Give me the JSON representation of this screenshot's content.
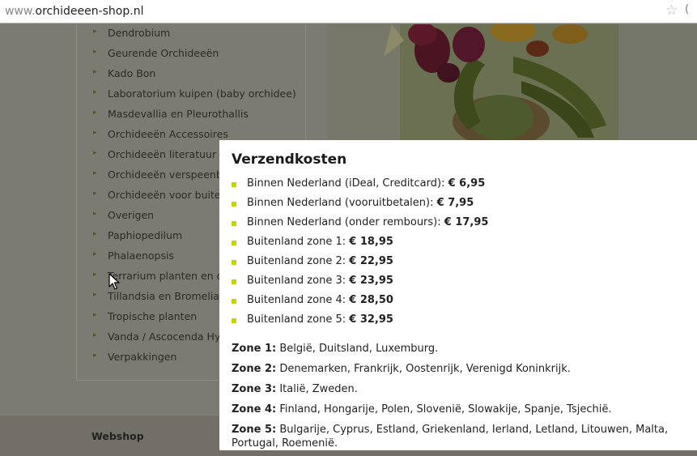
{
  "browser": {
    "url_prefix": "www.",
    "url_main": "orchideeen-shop.nl",
    "star_icon": "star-icon",
    "cut_glyph": "("
  },
  "sidebar": {
    "categories": [
      "Dendrobium",
      "Geurende Orchideeën",
      "Kado Bon",
      "Laboratorium kuipen (baby orchidee)",
      "Masdevallia en Pleurothallis",
      "Orchideeën Accessoires",
      "Orchideeën literatuur",
      "Orchideeën verspeenba",
      "Orchideeën voor buiter",
      "Overigen",
      "Paphiopedilum",
      "Phalaenopsis",
      "Terrarium planten en o",
      "Tillandsia en Bromelia",
      "Tropische planten",
      "Vanda / Ascocenda Hyb",
      "Verpakkingen"
    ],
    "arrow_icon": "chevron-right-icon"
  },
  "footer": {
    "webshop_label": "Webshop"
  },
  "modal": {
    "title": "Verzendkosten",
    "bullet_color": "#c3d400",
    "shipping": [
      {
        "label": "Binnen Nederland (iDeal, Creditcard):",
        "price": "€ 6,95"
      },
      {
        "label": "Binnen Nederland (vooruitbetalen):",
        "price": "€ 7,95"
      },
      {
        "label": "Binnen Nederland (onder rembours):",
        "price": "€ 17,95"
      },
      {
        "label": "Buitenland zone 1:",
        "price": "€ 18,95"
      },
      {
        "label": "Buitenland zone 2:",
        "price": "€ 22,95"
      },
      {
        "label": "Buitenland zone 3:",
        "price": "€ 23,95"
      },
      {
        "label": "Buitenland zone 4:",
        "price": "€ 28,50"
      },
      {
        "label": "Buitenland zone 5:",
        "price": "€ 32,95"
      }
    ],
    "zones": [
      {
        "label": "Zone 1:",
        "countries": "België, Duitsland, Luxemburg."
      },
      {
        "label": "Zone 2:",
        "countries": "Denemarken, Frankrijk, Oostenrijk, Verenigd Koninkrijk."
      },
      {
        "label": "Zone 3:",
        "countries": "Italië, Zweden."
      },
      {
        "label": "Zone 4:",
        "countries": "Finland, Hongarije, Polen, Slovenië, Slowakije, Spanje, Tsjechië."
      },
      {
        "label": "Zone 5:",
        "countries": "Bulgarije, Cyprus, Estland, Griekenland, Ierland, Letland, Litouwen, Malta, Portugal, Roemenië."
      }
    ]
  }
}
